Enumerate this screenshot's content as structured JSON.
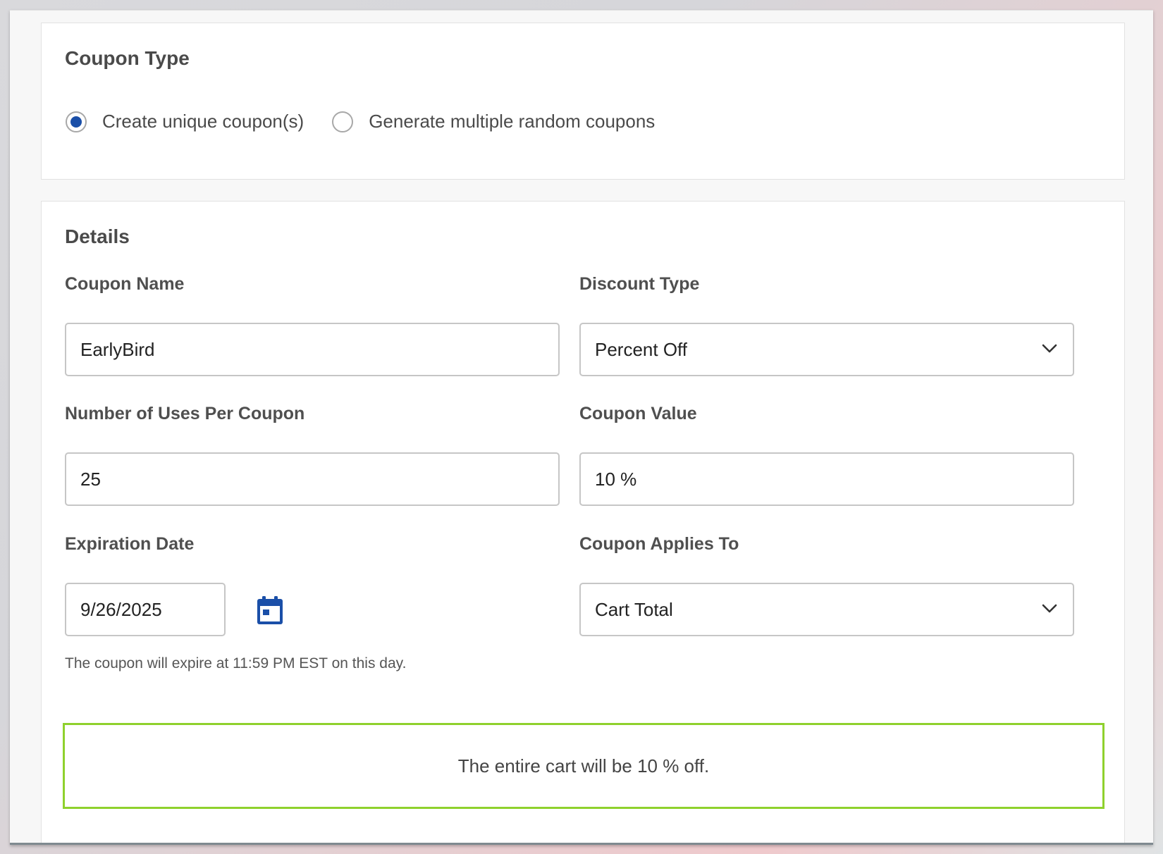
{
  "coupon_type": {
    "title": "Coupon Type",
    "options": [
      {
        "label": "Create unique coupon(s)",
        "selected": true
      },
      {
        "label": "Generate multiple random coupons",
        "selected": false
      }
    ]
  },
  "details": {
    "title": "Details",
    "coupon_name": {
      "label": "Coupon Name",
      "value": "EarlyBird"
    },
    "discount_type": {
      "label": "Discount Type",
      "value": "Percent Off"
    },
    "uses_per_coupon": {
      "label": "Number of Uses Per Coupon",
      "value": "25"
    },
    "coupon_value": {
      "label": "Coupon Value",
      "value": "10 %"
    },
    "expiration_date": {
      "label": "Expiration Date",
      "value": "9/26/2025",
      "hint": "The coupon will expire at 11:59 PM EST on this day."
    },
    "applies_to": {
      "label": "Coupon Applies To",
      "value": "Cart Total"
    },
    "summary": "The entire cart will be 10 % off."
  },
  "icons": {
    "calendar": "calendar-icon",
    "select_arrow": "chevron-down-icon"
  },
  "colors": {
    "accent_blue": "#1a4fa8",
    "summary_border": "#8fd12d"
  }
}
